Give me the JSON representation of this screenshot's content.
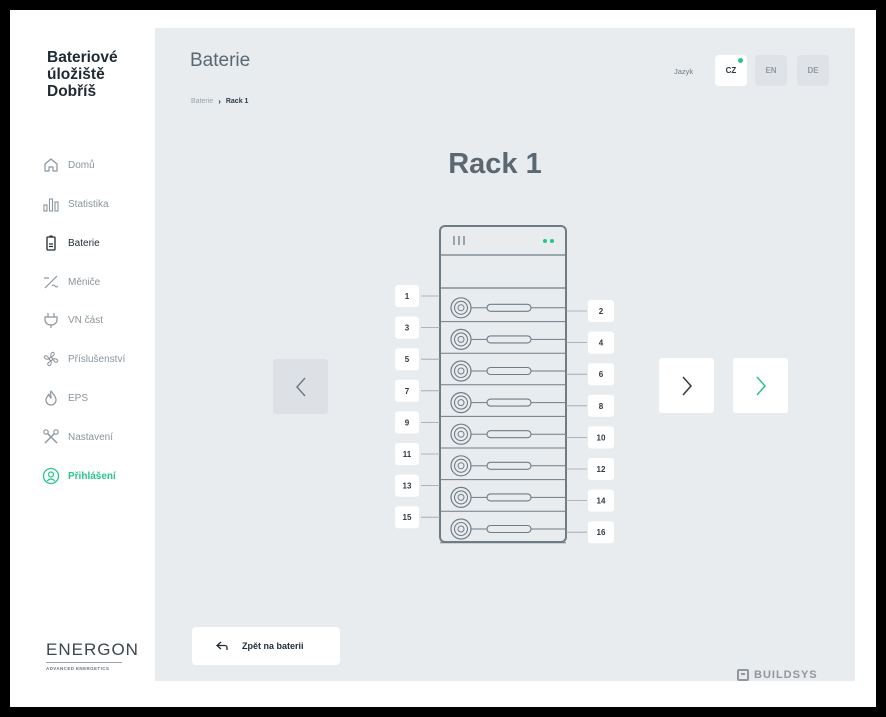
{
  "app": {
    "brand": "Bateriové úložiště Dobříš",
    "brand_lines": [
      "Bateriové",
      "úložiště",
      "Dobříš"
    ]
  },
  "sidebar": {
    "items": [
      {
        "label": "Domů",
        "icon": "home-icon"
      },
      {
        "label": "Statistika",
        "icon": "bar-chart-icon"
      },
      {
        "label": "Baterie",
        "icon": "battery-icon",
        "active": true
      },
      {
        "label": "Měniče",
        "icon": "inverter-icon"
      },
      {
        "label": "VN část",
        "icon": "plug-icon"
      },
      {
        "label": "Příslušenství",
        "icon": "fan-icon"
      },
      {
        "label": "EPS",
        "icon": "flame-icon"
      },
      {
        "label": "Nastavení",
        "icon": "tools-icon"
      },
      {
        "label": "Přihlášení",
        "icon": "user-circle-icon",
        "highlight": true
      }
    ]
  },
  "logo": {
    "name": "ENERGON",
    "tagline": "ADVANCED ENERGETICS"
  },
  "header": {
    "title": "Baterie",
    "breadcrumb": {
      "root": "Baterie",
      "current": "Rack 1"
    },
    "language_label": "Jazyk",
    "languages": [
      {
        "code": "CZ",
        "selected": true
      },
      {
        "code": "EN",
        "selected": false
      },
      {
        "code": "DE",
        "selected": false
      }
    ]
  },
  "rack": {
    "title": "Rack 1",
    "modules_left": [
      "1",
      "3",
      "5",
      "7",
      "9",
      "11",
      "13",
      "15"
    ],
    "modules_right": [
      "2",
      "4",
      "6",
      "8",
      "10",
      "12",
      "14",
      "16"
    ],
    "status_led_color": "#27c58a"
  },
  "actions": {
    "back_label": "Zpět na baterii"
  },
  "footer": {
    "vendor": "BUILDSYS"
  },
  "colors": {
    "accent": "#27c58a",
    "background": "#e9ecef",
    "rack_stroke": "#6f7c86"
  }
}
